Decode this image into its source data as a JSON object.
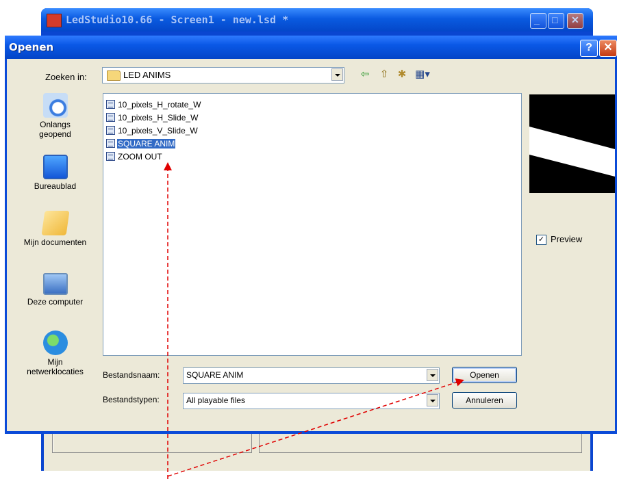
{
  "parent_window": {
    "title": "LedStudio10.66 - Screen1 - new.lsd *"
  },
  "dialog": {
    "title": "Openen",
    "help_glyph": "?",
    "close_glyph": "✕",
    "lookin_label": "Zoeken in:",
    "lookin_value": "LED ANIMS",
    "places": [
      {
        "label_line1": "Onlangs",
        "label_line2": "geopend",
        "icon": "recent-documents-icon"
      },
      {
        "label_line1": "Bureaublad",
        "label_line2": "",
        "icon": "desktop-icon"
      },
      {
        "label_line1": "Mijn documenten",
        "label_line2": "",
        "icon": "my-documents-icon"
      },
      {
        "label_line1": "Deze computer",
        "label_line2": "",
        "icon": "my-computer-icon"
      },
      {
        "label_line1": "Mijn",
        "label_line2": "netwerklocaties",
        "icon": "network-places-icon"
      }
    ],
    "files": [
      {
        "name": "10_pixels_H_rotate_W",
        "selected": false
      },
      {
        "name": "10_pixels_H_Slide_W",
        "selected": false
      },
      {
        "name": "10_pixels_V_Slide_W",
        "selected": false
      },
      {
        "name": "SQUARE ANIM",
        "selected": true
      },
      {
        "name": "ZOOM OUT",
        "selected": false
      }
    ],
    "preview_label": "Preview",
    "preview_checked": true,
    "filename_label": "Bestandsnaam:",
    "filename_value": "SQUARE ANIM",
    "filetype_label": "Bestandstypen:",
    "filetype_value": "All playable files",
    "open_button": "Openen",
    "cancel_button": "Annuleren"
  },
  "toolbar_icons": [
    "back-arrow-icon",
    "up-folder-icon",
    "new-folder-icon",
    "view-menu-icon"
  ],
  "colors": {
    "titlebar_blue": "#0a58e6",
    "dialog_face": "#ece9d8",
    "selection_blue": "#316ac5",
    "annotation_red": "#e00000"
  }
}
